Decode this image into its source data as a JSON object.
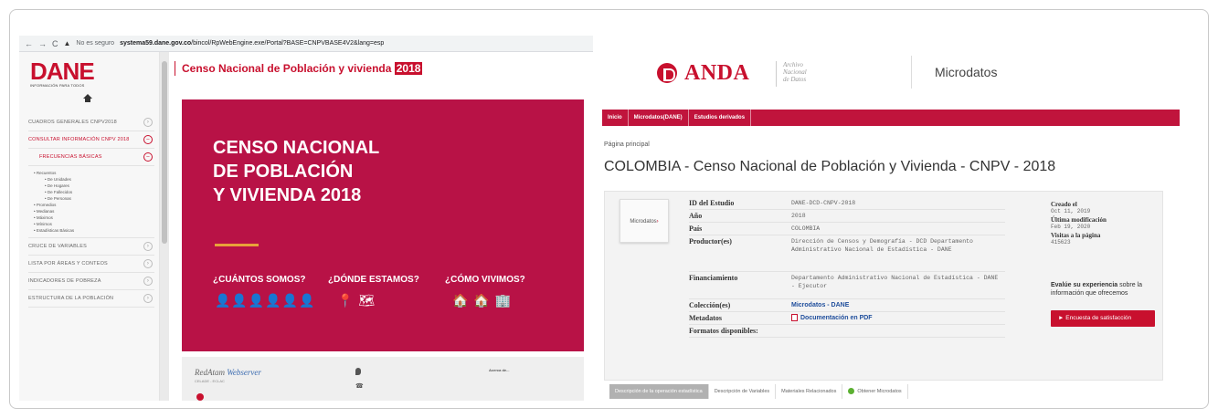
{
  "browser": {
    "insecure_label": "No es seguro",
    "url_domain": "systema59.dane.gov.co",
    "url_path": "/bincol/RpWebEngine.exe/Portal?BASE=CNPVBASE4V2&lang=esp"
  },
  "left": {
    "logo": "DANE",
    "logo_sub": "INFORMACIÓN PARA TODOS",
    "header_title": "Censo Nacional de Población y vivienda",
    "header_year": "2018",
    "menu": {
      "cuadros": "CUADROS GENERALES CNPV2018",
      "consultar": "CONSULTAR INFORMACIÓN CNPV 2018",
      "frecuencias": "FRECUENCIAS BÁSICAS",
      "sub_recuentos": "Recuentos",
      "sub_unidades": "De Unidades",
      "sub_hogares": "De Hogares",
      "sub_fallecidos": "De Fallecidos",
      "sub_personas": "De Personas",
      "sub_promedios": "Promedios",
      "sub_medianas": "Medianas",
      "sub_maximos": "Máximos",
      "sub_minimos": "Mínimos",
      "sub_estadisticas": "Estadísticas Básicas",
      "cruce": "CRUCE DE VARIABLES",
      "lista": "LISTA POR ÁREAS Y CONTEOS",
      "indicadores": "INDICADORES DE POBREZA",
      "estructura": "ESTRUCTURA DE LA POBLACIÓN"
    },
    "banner": {
      "line1": "CENSO NACIONAL",
      "line2": "DE POBLACIÓN",
      "line3": "Y VIVIENDA 2018",
      "q1": "¿CUÁNTOS SOMOS?",
      "q2": "¿DÓNDE ESTAMOS?",
      "q3": "¿CÓMO VIVIMOS?",
      "icons1": "👤👤👤👤👤👤",
      "icons2": "📍 🗺",
      "icons3": "🏠 🏠 🏢"
    },
    "footer": {
      "brand1": "RedAtam",
      "brand2": "Webserver",
      "small1": "CELADE - ECLAC",
      "small2": "Acerca de..."
    }
  },
  "right": {
    "logo": "ANDA",
    "logo_sub1": "Archivo",
    "logo_sub2": "Nacional",
    "logo_sub3": "de Datos",
    "site_title": "Microdatos",
    "nav": [
      "Inicio",
      "Microdatos(DANE)",
      "Estudios derivados"
    ],
    "breadcrumb": "Página principal",
    "title": "COLOMBIA - Censo Nacional de Población y Vivienda - CNPV - 2018",
    "thumbnail_label": "Microdatos",
    "fields": {
      "id_k": "ID del Estudio",
      "id_v": "DANE-DCD-CNPV-2018",
      "anio_k": "Año",
      "anio_v": "2018",
      "pais_k": "País",
      "pais_v": "COLOMBIA",
      "prod_k": "Productor(es)",
      "prod_v": "Dirección de Censos y Demografía - DCD Departamento Administrativo Nacional de Estadística - DANE",
      "fin_k": "Financiamiento",
      "fin_v": "Departamento Administrativo Nacional de Estadística - DANE - Ejecutor",
      "col_k": "Colección(es)",
      "col_v": "Microdatos - DANE",
      "meta_k": "Metadatos",
      "meta_v": "Documentación en PDF",
      "form_k": "Formatos disponibles:"
    },
    "meta": {
      "creado_k": "Creado el",
      "creado_v": "Oct 11, 2019",
      "mod_k": "Última modificación",
      "mod_v": "Feb 19, 2020",
      "vis_k": "Visitas a la página",
      "vis_v": "415623"
    },
    "eval_bold": "Evalúe su experiencia",
    "eval_rest": " sobre la información que ofrecemos",
    "survey_button": "► Encuesta de satisfacción",
    "tabs": [
      "Descripción de la operación estadística",
      "Descripción de Variables",
      "Materiales Relacionados",
      "Obtener Microdatos"
    ]
  }
}
